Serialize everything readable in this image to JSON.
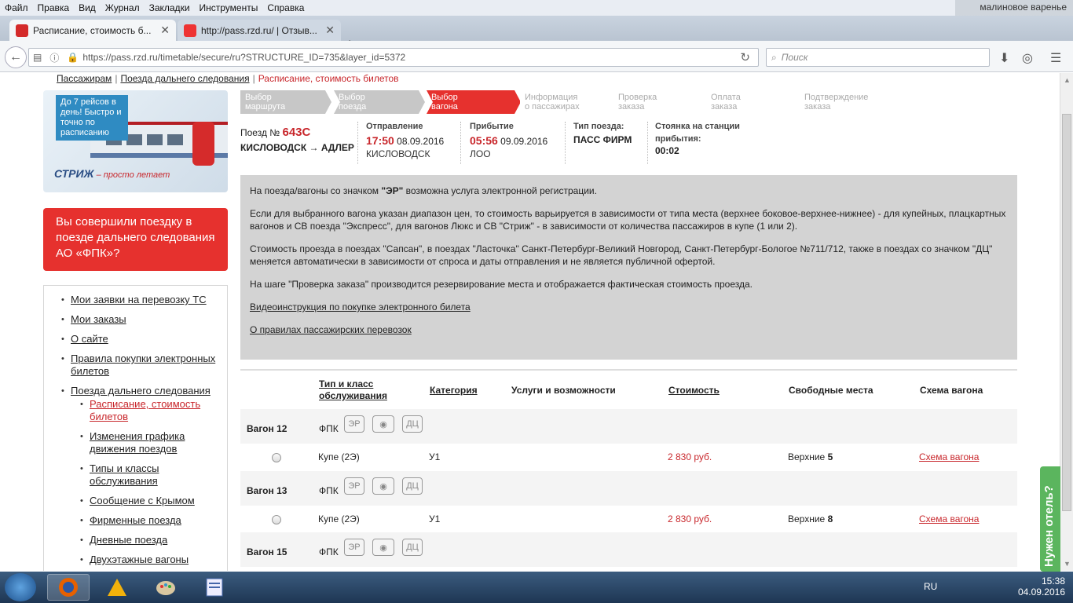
{
  "menubar": [
    "Файл",
    "Правка",
    "Вид",
    "Журнал",
    "Закладки",
    "Инструменты",
    "Справка"
  ],
  "corner_text": "малиновое варенье",
  "tabs": [
    {
      "label": "Расписание, стоимость б..."
    },
    {
      "label": "http://pass.rzd.ru/ | Отзыв..."
    }
  ],
  "url": "https://pass.rzd.ru/timetable/secure/ru?STRUCTURE_ID=735&layer_id=5372",
  "search_placeholder": "Поиск",
  "breadcrumbs": {
    "a": "Пассажирам",
    "b": "Поезда дальнего следования",
    "c": "Расписание, стоимость билетов"
  },
  "promo": {
    "text": "До 7 рейсов в день! Быстро и точно по расписанию",
    "logo": "СТРИЖ",
    "tagline": " – просто летает"
  },
  "fpk_banner": "Вы совершили поездку в поезде дальнего следования АО «ФПК»?",
  "nav": [
    "Мои заявки на перевозку ТС",
    "Мои заказы",
    "О сайте",
    "Правила покупки электронных билетов",
    "Поезда дальнего следования"
  ],
  "subnav": [
    "Расписание, стоимость билетов",
    "Изменения графика движения поездов",
    "Типы и классы обслуживания",
    "Сообщение с Крымом",
    "Фирменные поезда",
    "Дневные поезда",
    "Двухэтажные вагоны"
  ],
  "steps": [
    {
      "l1": "Выбор",
      "l2": "маршрута"
    },
    {
      "l1": "Выбор",
      "l2": "поезда"
    },
    {
      "l1": "Выбор",
      "l2": "вагона"
    },
    {
      "l1": "Информация",
      "l2": "о пассажирах"
    },
    {
      "l1": "Проверка",
      "l2": "заказа"
    },
    {
      "l1": "Оплата",
      "l2": "заказа"
    },
    {
      "l1": "Подтверждение",
      "l2": "заказа"
    }
  ],
  "train": {
    "label": "Поезд №",
    "number": "643С",
    "route": "КИСЛОВОДСК → АДЛЕР",
    "dep_label": "Отправление",
    "dep_time": "17:50",
    "dep_date": "08.09.2016",
    "dep_station": "КИСЛОВОДСК",
    "arr_label": "Прибытие",
    "arr_time": "05:56",
    "arr_date": "09.09.2016",
    "arr_station": "ЛОО",
    "type_label": "Тип поезда:",
    "type": "ПАСС ФИРМ",
    "stop_label1": "Стоянка на станции",
    "stop_label2": "прибытия:",
    "stop": "00:02"
  },
  "info": {
    "p1_a": "На поезда/вагоны со значком ",
    "p1_b": "\"ЭР\"",
    "p1_c": " возможна услуга электронной регистрации.",
    "p2": "Если для выбранного вагона указан диапазон цен, то стоимость варьируется в зависимости от типа места (верхнее боковое-верхнее-нижнее) - для купейных, плацкартных вагонов и СВ поезда \"Экспресс\", для вагонов Люкс и СВ \"Стриж\" - в зависимости от количества пассажиров в купе (1 или 2).",
    "p3": "Стоимость проезда в поездах \"Сапсан\", в поездах \"Ласточка\" Санкт-Петербург-Великий Новгород, Санкт-Петербург-Бологое №711/712, также в поездах со значком \"ДЦ\" меняется автоматически в зависимости от спроса и даты отправления и не является публичной офертой.",
    "p4": "На шаге \"Проверка заказа\" производится резервирование места и отображается фактическая стоимость проезда.",
    "link1": "Видеоинструкция по покупке электронного билета",
    "link2": "О правилах пассажирских перевозок"
  },
  "table_headers": {
    "type1": "Тип и класс",
    "type2": "обслуживания",
    "cat": "Категория",
    "svc": "Услуги и возможности",
    "price": "Стоимость",
    "free": "Свободные места",
    "scheme": "Схема вагона"
  },
  "badges": [
    "ЭР",
    "◉",
    "ДЦ"
  ],
  "wagons": [
    {
      "name": "Вагон 12",
      "carrier": "ФПК",
      "type": "Купе (2Э)",
      "cat": "У1",
      "price": "2 830 руб.",
      "seats_label": "Верхние",
      "seats": "5",
      "link": "Схема вагона"
    },
    {
      "name": "Вагон 13",
      "carrier": "ФПК",
      "type": "Купе (2Э)",
      "cat": "У1",
      "price": "2 830 руб.",
      "seats_label": "Верхние",
      "seats": "8",
      "link": "Схема вагона"
    },
    {
      "name": "Вагон 15",
      "carrier": "ФПК"
    }
  ],
  "hotel_tab": "Нужен отель?",
  "tray": {
    "lang": "RU",
    "time": "15:38",
    "date": "04.09.2016"
  }
}
